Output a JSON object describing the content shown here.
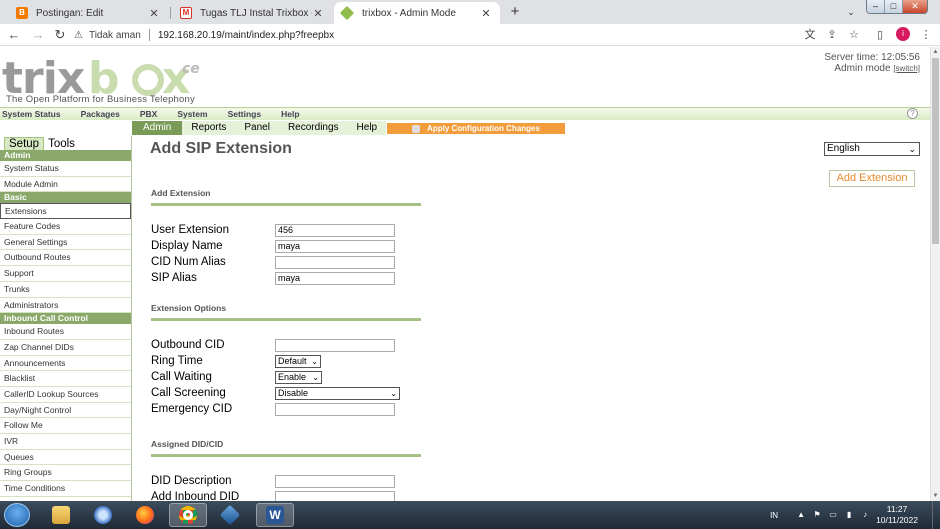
{
  "browser": {
    "tabs": [
      {
        "title": "Postingan: Edit",
        "icon": "blogger-icon",
        "active": false
      },
      {
        "title": "Tugas TLJ Instal Trixbox - nismayu",
        "icon": "gmail-icon",
        "active": false
      },
      {
        "title": "trixbox - Admin Mode",
        "icon": "trixbox-icon",
        "active": true
      }
    ],
    "security_label": "Tidak aman",
    "url": "192.168.20.19/maint/index.php?freepbx",
    "profile_initial": "i"
  },
  "header": {
    "logo_text": "trixbox",
    "logo_suffix": "ce",
    "tagline": "The Open Platform for Business Telephony",
    "server_time": "Server time: 12:05:56",
    "admin_mode": "Admin mode",
    "switch_label": "[switch]"
  },
  "topnav": [
    "System Status",
    "Packages",
    "PBX",
    "System",
    "Settings",
    "Help"
  ],
  "subnav": {
    "items": [
      "Admin",
      "Reports",
      "Panel",
      "Recordings",
      "Help"
    ],
    "active": "Admin",
    "apply_label": "Apply Configuration Changes"
  },
  "sidebar": {
    "tabs": [
      "Setup",
      "Tools"
    ],
    "admin_header": "Admin",
    "admin_items": [
      "System Status",
      "Module Admin"
    ],
    "basic_header": "Basic",
    "basic_items": [
      "Extensions",
      "Feature Codes",
      "General Settings",
      "Outbound Routes",
      "Support",
      "Trunks",
      "Administrators"
    ],
    "inbound_header": "Inbound Call Control",
    "inbound_items": [
      "Inbound Routes",
      "Zap Channel DIDs",
      "Announcements",
      "Blacklist",
      "CallerID Lookup Sources",
      "Day/Night Control",
      "Follow Me",
      "IVR",
      "Queues",
      "Ring Groups",
      "Time Conditions"
    ]
  },
  "main": {
    "title": "Add SIP Extension",
    "language": "English",
    "add_extension_button": "Add Extension",
    "sections": {
      "add_extension": "Add Extension",
      "extension_options": "Extension Options",
      "assigned_did": "Assigned DID/CID"
    },
    "fields": {
      "user_extension": {
        "label": "User Extension",
        "value": "456"
      },
      "display_name": {
        "label": "Display Name",
        "value": "maya"
      },
      "cid_num_alias": {
        "label": "CID Num Alias",
        "value": ""
      },
      "sip_alias": {
        "label": "SIP Alias",
        "value": "maya"
      },
      "outbound_cid": {
        "label": "Outbound CID",
        "value": ""
      },
      "ring_time": {
        "label": "Ring Time",
        "value": "Default"
      },
      "call_waiting": {
        "label": "Call Waiting",
        "value": "Enable"
      },
      "call_screening": {
        "label": "Call Screening",
        "value": "Disable"
      },
      "emergency_cid": {
        "label": "Emergency CID",
        "value": ""
      },
      "did_description": {
        "label": "DID Description",
        "value": ""
      },
      "add_inbound_did": {
        "label": "Add Inbound DID",
        "value": ""
      }
    }
  },
  "taskbar": {
    "apps": [
      "explorer-icon",
      "thunderbird-icon",
      "firefox-icon",
      "chrome-icon",
      "virtualbox-icon",
      "word-icon"
    ],
    "lang": "IN",
    "time": "11:27",
    "date": "10/11/2022"
  },
  "colors": {
    "brand_green": "#8aa86a",
    "accent_orange": "#f39c3c",
    "subnav_bg": "#e6f1da"
  }
}
